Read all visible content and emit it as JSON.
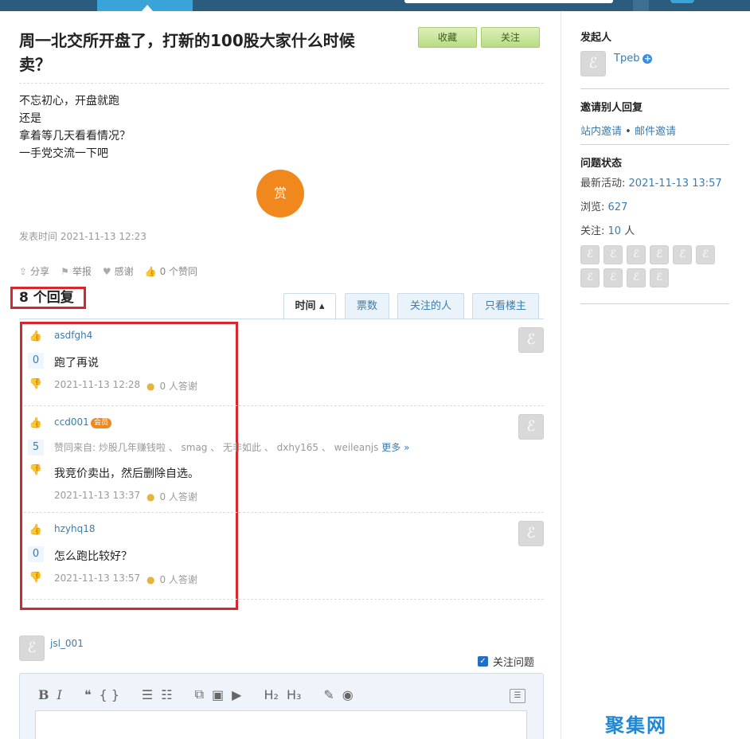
{
  "question": {
    "title": "周一北交所开盘了，打新的100股大家什么时候卖？",
    "favorite_label": "收藏",
    "follow_label": "关注",
    "body_lines": [
      "不忘初心，开盘就跑",
      "还是",
      "拿着等几天看看情况？",
      "一手党交流一下吧"
    ],
    "reward_label": "赏",
    "post_time": "发表时间 2021-11-13 12:23",
    "actions": {
      "share": "分享",
      "report": "举报",
      "thank": "感谢",
      "agree": "0 个赞同"
    }
  },
  "replies": {
    "count_label": "8 个回复",
    "tabs": [
      {
        "label": "时间 ▴",
        "active": true
      },
      {
        "label": "票数",
        "active": false
      },
      {
        "label": "关注的人",
        "active": false
      },
      {
        "label": "只看楼主",
        "active": false
      }
    ],
    "items": [
      {
        "user": "asdfgh4",
        "votes": "0",
        "text": "跑了再说",
        "time": "2021-11-13 12:28",
        "thanks": "0 人答谢"
      },
      {
        "user": "ccd001",
        "badge": "会员",
        "votes": "5",
        "agree_prefix": "赞同来自:",
        "agree_users": "炒股几年赚钱啦 、 smag 、 无非如此 、 dxhy165 、 weileanjs",
        "agree_more": "更多 »",
        "text": "我竞价卖出，然后删除自选。",
        "time": "2021-11-13 13:37",
        "thanks": "0 人答谢"
      },
      {
        "user": "hzyhq18",
        "votes": "0",
        "text": "怎么跑比较好？",
        "time": "2021-11-13 13:57",
        "thanks": "0 人答谢"
      }
    ]
  },
  "comment": {
    "user": "jsl_001",
    "follow_question_label": "关注问题",
    "toolbar": {
      "bold": "B",
      "italic": "I",
      "quote": "❝",
      "code": "{ }",
      "ul": "☰",
      "ol": "☷",
      "link": "⧉",
      "image": "▣",
      "video": "▶",
      "h2": "H₂",
      "h3": "H₃",
      "eraser": "✎",
      "preview": "◉"
    }
  },
  "sidebar": {
    "initiator_title": "发起人",
    "initiator_name": "Tpeb",
    "invite_title": "邀请别人回复",
    "invite_site": "站内邀请",
    "invite_sep": "•",
    "invite_email": "邮件邀请",
    "status_title": "问题状态",
    "last_activity_label": "最新活动:",
    "last_activity_value": "2021-11-13 13:57",
    "views_label": "浏览:",
    "views_value": "627",
    "follows_label": "关注:",
    "follows_value": "10",
    "follows_unit": "人"
  },
  "watermark": "聚集网",
  "colors": {
    "accent": "#3a7cb0",
    "highlight_red": "#d8262e",
    "reward_orange": "#f0881e",
    "nav_dark": "#2b5c7e"
  }
}
